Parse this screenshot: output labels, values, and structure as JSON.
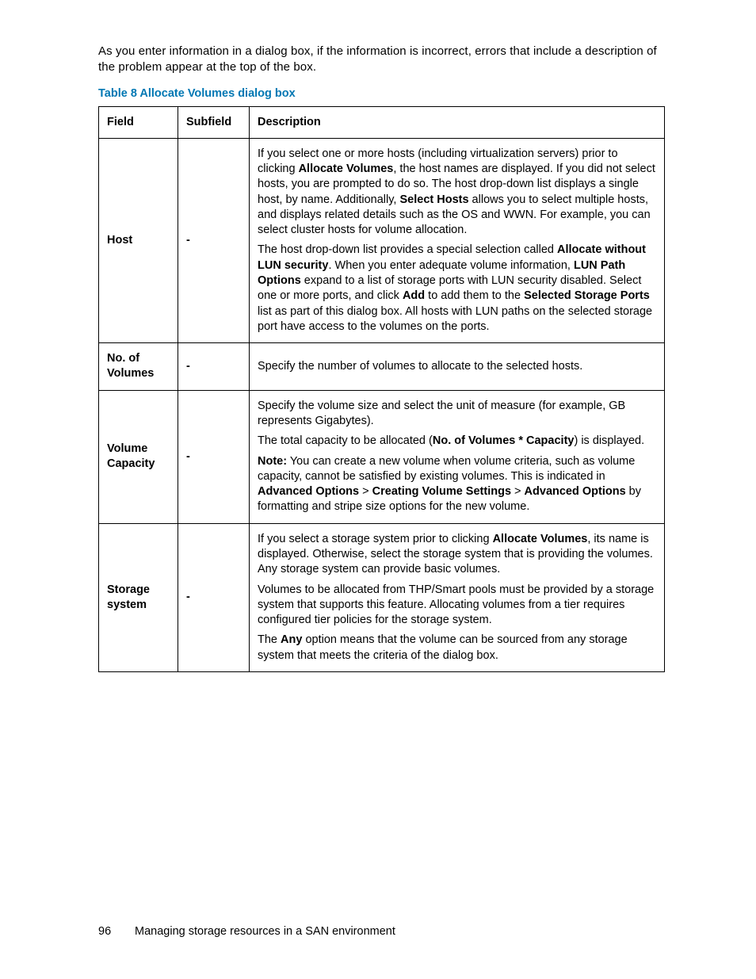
{
  "intro": "As you enter information in a dialog box, if the information is incorrect, errors that include a description of the problem appear at the top of the box.",
  "caption": "Table 8 Allocate Volumes dialog box",
  "headers": {
    "field": "Field",
    "subfield": "Subfield",
    "description": "Description"
  },
  "rows": {
    "host": {
      "field": "Host",
      "subfield": "-",
      "p1a": "If you select one or more hosts (including virtualization servers) prior to clicking ",
      "p1b": "Allocate Volumes",
      "p1c": ", the host names are displayed. If you did not select hosts, you are prompted to do so. The host drop-down list displays a single host, by name. Additionally, ",
      "p1d": "Select Hosts",
      "p1e": " allows you to select multiple hosts, and displays related details such as the OS and WWN. For example, you can select cluster hosts for volume allocation.",
      "p2a": "The host drop-down list provides a special selection called ",
      "p2b": "Allocate without LUN security",
      "p2c": ". When you enter adequate volume information, ",
      "p2d": "LUN Path Options",
      "p2e": " expand to a list of storage ports with LUN security disabled. Select one or more ports, and click ",
      "p2f": "Add",
      "p2g": " to add them to the ",
      "p2h": "Selected Storage Ports",
      "p2i": " list as part of this dialog box. All hosts with LUN paths on the selected storage port have access to the volumes on the ports."
    },
    "num": {
      "field": "No. of Volumes",
      "subfield": "-",
      "desc": "Specify the number of volumes to allocate to the selected hosts."
    },
    "cap": {
      "field": "Volume Capa­city",
      "subfield": "-",
      "p1": "Specify the volume size and select the unit of measure (for example, GB represents Gigabytes).",
      "p2a": "The total capacity to be allocated (",
      "p2b": "No. of Volumes * Capacity",
      "p2c": ") is displayed.",
      "p3a": "Note:",
      "p3b": " You can create a new volume when volume criteria, such as volume capacity, cannot be satisfied by existing volumes. This is indicated in ",
      "p3c": "Advanced Options",
      "gt1": " > ",
      "p3d": "Creating Volume Settings",
      "gt2": " > ",
      "p3e": "Advanced Options",
      "p3f": " by formatting and stripe size options for the new volume."
    },
    "stor": {
      "field": "Storage sys­tem",
      "subfield": "-",
      "p1a": "If you select a storage system prior to clicking ",
      "p1b": "Allocate Volumes",
      "p1c": ", its name is displayed. Otherwise, select the storage system that is providing the volumes. Any storage system can provide basic volumes.",
      "p2": "Volumes to be allocated from THP/Smart pools must be provided by a storage system that supports this feature. Allocating volumes from a tier requires configured tier policies for the storage system.",
      "p3a": "The ",
      "p3b": "Any",
      "p3c": " option means that the volume can be sourced from any storage system that meets the criteria of the dialog box."
    }
  },
  "footer": {
    "page": "96",
    "title": "Managing storage resources in a SAN environment"
  }
}
